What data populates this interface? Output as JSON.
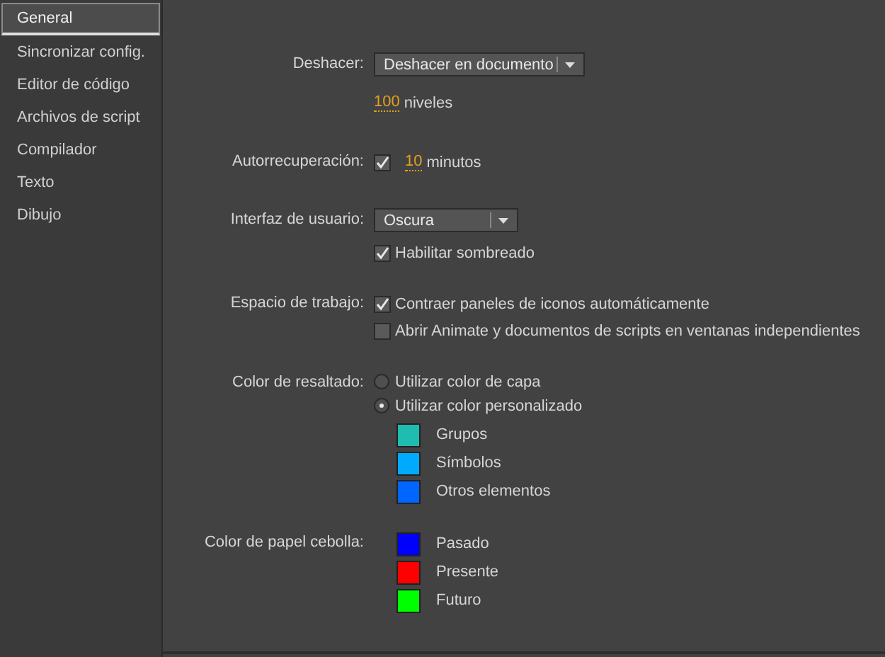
{
  "sidebar": {
    "items": [
      {
        "label": "General",
        "selected": true
      },
      {
        "label": "Sincronizar config.",
        "selected": false
      },
      {
        "label": "Editor de código",
        "selected": false
      },
      {
        "label": "Archivos de script",
        "selected": false
      },
      {
        "label": "Compilador",
        "selected": false
      },
      {
        "label": "Texto",
        "selected": false
      },
      {
        "label": "Dibujo",
        "selected": false
      }
    ]
  },
  "undo": {
    "label": "Deshacer:",
    "dropdown": "Deshacer en documento",
    "levels_value": "100",
    "levels_unit": "niveles"
  },
  "autorecovery": {
    "label": "Autorrecuperación:",
    "checked": true,
    "value": "10",
    "unit": "minutos"
  },
  "interface": {
    "label": "Interfaz de usuario:",
    "dropdown": "Oscura",
    "shading": {
      "label": "Habilitar sombreado",
      "checked": true
    }
  },
  "workspace": {
    "label": "Espacio de trabajo:",
    "options": [
      {
        "label": "Contraer paneles de iconos automáticamente",
        "checked": true
      },
      {
        "label": "Abrir Animate y documentos de scripts en ventanas independientes",
        "checked": false
      }
    ]
  },
  "highlight": {
    "label": "Color de resaltado:",
    "options": [
      {
        "label": "Utilizar color de capa",
        "selected": false
      },
      {
        "label": "Utilizar color personalizado",
        "selected": true
      }
    ],
    "swatches": [
      {
        "label": "Grupos",
        "color": "#1fbcb0"
      },
      {
        "label": "Símbolos",
        "color": "#00aaff"
      },
      {
        "label": "Otros elementos",
        "color": "#0066ff"
      }
    ]
  },
  "onion": {
    "label": "Color de papel cebolla:",
    "swatches": [
      {
        "label": "Pasado",
        "color": "#0000ff"
      },
      {
        "label": "Presente",
        "color": "#ff0000"
      },
      {
        "label": "Futuro",
        "color": "#00ff00"
      }
    ]
  }
}
